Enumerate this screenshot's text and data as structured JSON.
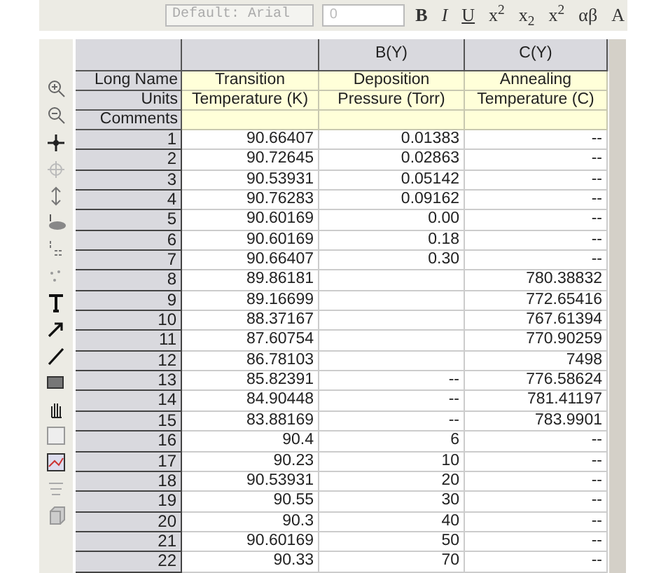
{
  "toolbar": {
    "font_box": "Default: Arial",
    "size_box": "0",
    "format_buttons": [
      "B",
      "I",
      "U",
      "x$^{2}$",
      "x$_{2}$",
      "x$^{2}$",
      "αβ",
      "A"
    ]
  },
  "worksheet": {
    "columns": [
      {
        "long_name": "Transition",
        "units": "Temperature (K)"
      },
      {
        "header": "B(Y)",
        "long_name": "Deposition",
        "units": "Pressure (Torr)"
      },
      {
        "header": "C(Y)",
        "long_name": "Annealing",
        "units": "Temperature (C)"
      }
    ],
    "label_rows": [
      "Long Name",
      "Units",
      "Comments"
    ],
    "rows": [
      {
        "index": "1",
        "cells": [
          "90.66407",
          "0.01383",
          "--"
        ]
      },
      {
        "index": "2",
        "cells": [
          "90.72645",
          "0.02863",
          "--"
        ]
      },
      {
        "index": "3",
        "cells": [
          "90.53931",
          "0.05142",
          "--"
        ]
      },
      {
        "index": "4",
        "cells": [
          "90.76283",
          "0.09162",
          "--"
        ]
      },
      {
        "index": "5",
        "cells": [
          "90.60169",
          "0.00",
          "--"
        ]
      },
      {
        "index": "6",
        "cells": [
          "90.60169",
          "0.18",
          "--"
        ]
      },
      {
        "index": "7",
        "cells": [
          "90.66407",
          "0.30",
          "--"
        ]
      },
      {
        "index": "8",
        "cells": [
          "89.86181",
          null,
          "780.38832"
        ]
      },
      {
        "index": "9",
        "cells": [
          "89.16699",
          null,
          "772.65416"
        ]
      },
      {
        "index": "10",
        "cells": [
          "88.37167",
          null,
          "767.61394"
        ]
      },
      {
        "index": "11",
        "cells": [
          "87.60754",
          null,
          "770.90259"
        ]
      },
      {
        "index": "12",
        "cells": [
          "86.78103",
          null,
          "7498"
        ]
      },
      {
        "index": "13",
        "cells": [
          "85.82391",
          "--",
          "776.58624"
        ]
      },
      {
        "index": "14",
        "cells": [
          "84.90448",
          "--",
          "781.41197"
        ]
      },
      {
        "index": "15",
        "cells": [
          "83.88169",
          "--",
          "783.9901"
        ]
      },
      {
        "index": "16",
        "cells": [
          "90.4",
          "6",
          "--"
        ]
      },
      {
        "index": "17",
        "cells": [
          "90.23",
          "10",
          "--"
        ]
      },
      {
        "index": "18",
        "cells": [
          "90.53931",
          "20",
          "--"
        ]
      },
      {
        "index": "19",
        "cells": [
          "90.55",
          "30",
          "--"
        ]
      },
      {
        "index": "20",
        "cells": [
          "90.3",
          "40",
          "--"
        ]
      },
      {
        "index": "21",
        "cells": [
          "90.60169",
          "50",
          "--"
        ]
      },
      {
        "index": "22",
        "cells": [
          "90.33",
          "70",
          "--"
        ]
      }
    ]
  }
}
